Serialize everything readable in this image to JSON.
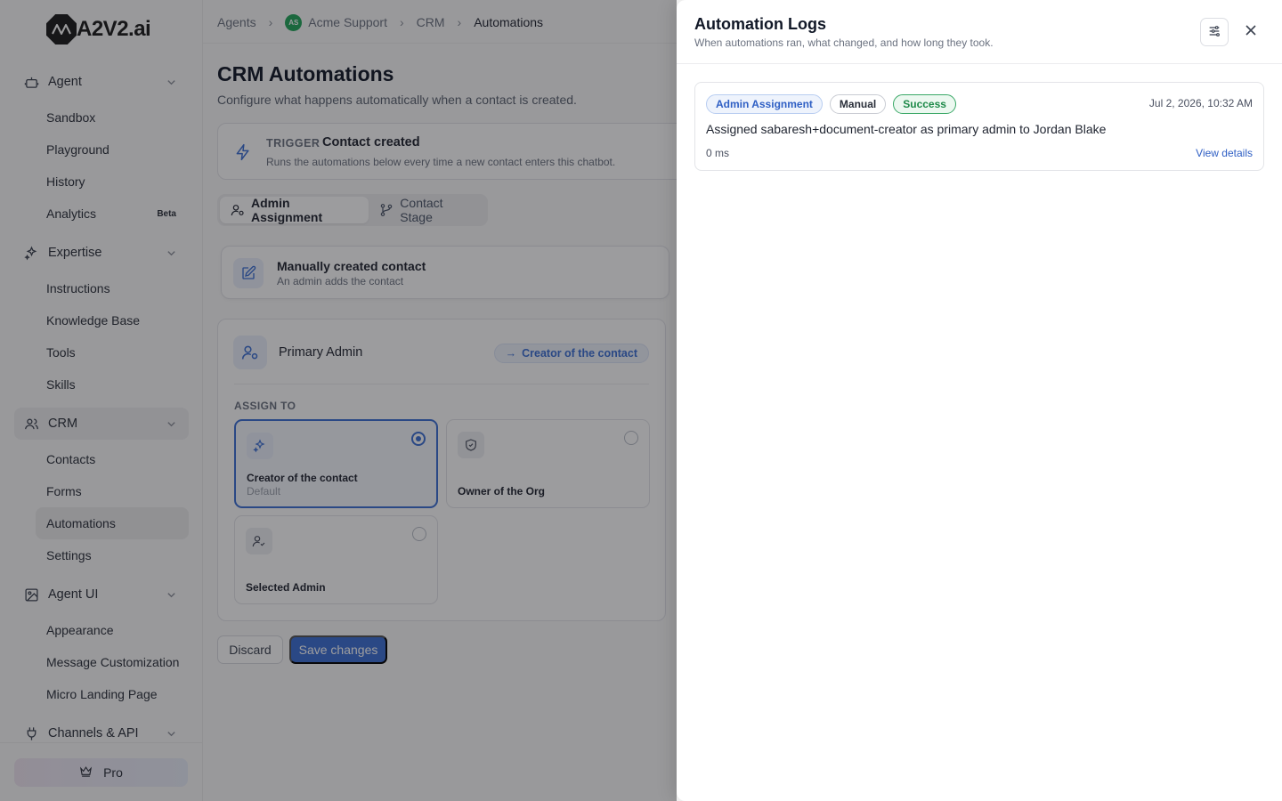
{
  "brand": {
    "name": "A2V2.ai"
  },
  "sidebar": {
    "groups": [
      {
        "label": "Agent",
        "icon": "bot-icon",
        "items": [
          {
            "label": "Sandbox"
          },
          {
            "label": "Playground"
          },
          {
            "label": "History"
          },
          {
            "label": "Analytics",
            "badge": "Beta"
          }
        ]
      },
      {
        "label": "Expertise",
        "icon": "sparkles-icon",
        "items": [
          {
            "label": "Instructions"
          },
          {
            "label": "Knowledge Base"
          },
          {
            "label": "Tools"
          },
          {
            "label": "Skills"
          }
        ]
      },
      {
        "label": "CRM",
        "icon": "users-icon",
        "items": [
          {
            "label": "Contacts"
          },
          {
            "label": "Forms"
          },
          {
            "label": "Automations"
          },
          {
            "label": "Settings"
          }
        ]
      },
      {
        "label": "Agent UI",
        "icon": "image-icon",
        "items": [
          {
            "label": "Appearance"
          },
          {
            "label": "Message Customization"
          },
          {
            "label": "Micro Landing Page"
          }
        ]
      },
      {
        "label": "Channels & API",
        "icon": "plug-icon",
        "items": []
      }
    ],
    "active_group": "CRM",
    "active_item": "Automations",
    "pro_label": "Pro"
  },
  "breadcrumb": {
    "items": [
      "Agents",
      "Acme Support",
      "CRM",
      "Automations"
    ],
    "avatar_initials": "AS"
  },
  "page": {
    "title": "CRM Automations",
    "subtitle": "Configure what happens automatically when a contact is created."
  },
  "trigger": {
    "label": "TRIGGER",
    "title": "Contact created",
    "description": "Runs the automations below every time a new contact enters this chatbot."
  },
  "tabs": [
    {
      "label": "Admin Assignment",
      "active": true
    },
    {
      "label": "Contact Stage",
      "active": false
    }
  ],
  "source": {
    "title": "Manually created contact",
    "description": "An admin adds the contact"
  },
  "admin": {
    "title": "Primary Admin",
    "chip": "Creator of the contact",
    "assign_label": "ASSIGN TO",
    "options": [
      {
        "title": "Creator of the contact",
        "subtitle": "Default",
        "selected": true
      },
      {
        "title": "Owner of the Org",
        "subtitle": "",
        "selected": false
      },
      {
        "title": "Selected Admin",
        "subtitle": "",
        "selected": false
      }
    ]
  },
  "actions": {
    "discard": "Discard",
    "save": "Save changes"
  },
  "logs": {
    "title": "Automation Logs",
    "subtitle": "When automations ran, what changed, and how long they took.",
    "entries": [
      {
        "type": "Admin Assignment",
        "mode": "Manual",
        "status": "Success",
        "time": "Jul 2, 2026, 10:32 AM",
        "message": "Assigned sabaresh+document-creator as primary admin to Jordan Blake",
        "duration": "0 ms",
        "link": "View details"
      }
    ]
  },
  "colors": {
    "accent": "#3b6fd4",
    "success": "#1e8a49",
    "overlay": "rgba(20,20,24,0.42)"
  }
}
